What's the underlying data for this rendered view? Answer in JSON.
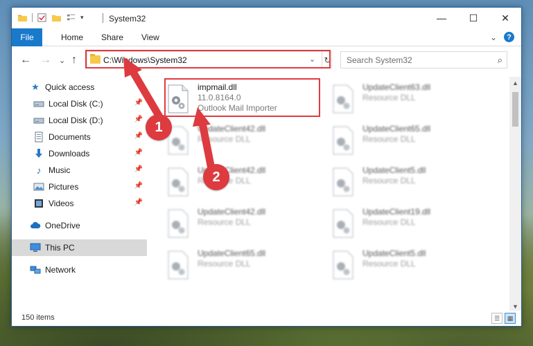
{
  "window": {
    "title": "System32",
    "minimize": "—",
    "maximize": "☐",
    "close": "✕"
  },
  "ribbon": {
    "tabs": [
      "File",
      "Home",
      "Share",
      "View"
    ],
    "collapse": "⌄",
    "help": "?"
  },
  "nav": {
    "back": "←",
    "forward": "→",
    "recent": "⌄",
    "up": "↑",
    "address": "C:\\Windows\\System32",
    "address_dropdown": "⌄",
    "refresh": "↻"
  },
  "search": {
    "placeholder": "Search System32",
    "icon": "search-icon"
  },
  "sidebar": {
    "items": [
      {
        "label": "Quick access",
        "icon": "star-icon",
        "pinned": false
      },
      {
        "label": "Local Disk (C:)",
        "icon": "drive-icon",
        "pinned": true
      },
      {
        "label": "Local Disk (D:)",
        "icon": "drive-icon",
        "pinned": true
      },
      {
        "label": "Documents",
        "icon": "documents-icon",
        "pinned": true
      },
      {
        "label": "Downloads",
        "icon": "download-icon",
        "pinned": true
      },
      {
        "label": "Music",
        "icon": "music-icon",
        "pinned": true
      },
      {
        "label": "Pictures",
        "icon": "pictures-icon",
        "pinned": true
      },
      {
        "label": "Videos",
        "icon": "videos-icon",
        "pinned": true
      },
      {
        "label": "OneDrive",
        "icon": "cloud-icon",
        "pinned": false
      },
      {
        "label": "This PC",
        "icon": "computer-icon",
        "pinned": false
      },
      {
        "label": "Network",
        "icon": "network-icon",
        "pinned": false
      }
    ],
    "pin_glyph": "📌"
  },
  "files": {
    "left": [
      {
        "name": "impmail.dll",
        "line2": "11.0.8164.0",
        "line3": "Outlook Mail Importer"
      },
      {
        "name": "UpdateClient42.dll",
        "line2": "Resource DLL",
        "line3": ""
      },
      {
        "name": "UpdateClient42.dll",
        "line2": "Resource DLL",
        "line3": ""
      },
      {
        "name": "UpdateClient42.dll",
        "line2": "Resource DLL",
        "line3": ""
      },
      {
        "name": "UpdateClient65.dll",
        "line2": "Resource DLL",
        "line3": ""
      }
    ],
    "right": [
      {
        "name": "UpdateClient63.dll",
        "line2": "Resource DLL"
      },
      {
        "name": "UpdateClient65.dll",
        "line2": "Resource DLL"
      },
      {
        "name": "UpdateClient5.dll",
        "line2": "Resource DLL"
      },
      {
        "name": "UpdateClient19.dll",
        "line2": "Resource DLL"
      },
      {
        "name": "UpdateClient5.dll",
        "line2": "Resource DLL"
      }
    ]
  },
  "status": {
    "count": "150 items"
  },
  "annotations": {
    "badge1": "1",
    "badge2": "2",
    "color": "#dd3b3f"
  },
  "colors": {
    "accent": "#1979ca",
    "highlight": "#e03a3f"
  }
}
